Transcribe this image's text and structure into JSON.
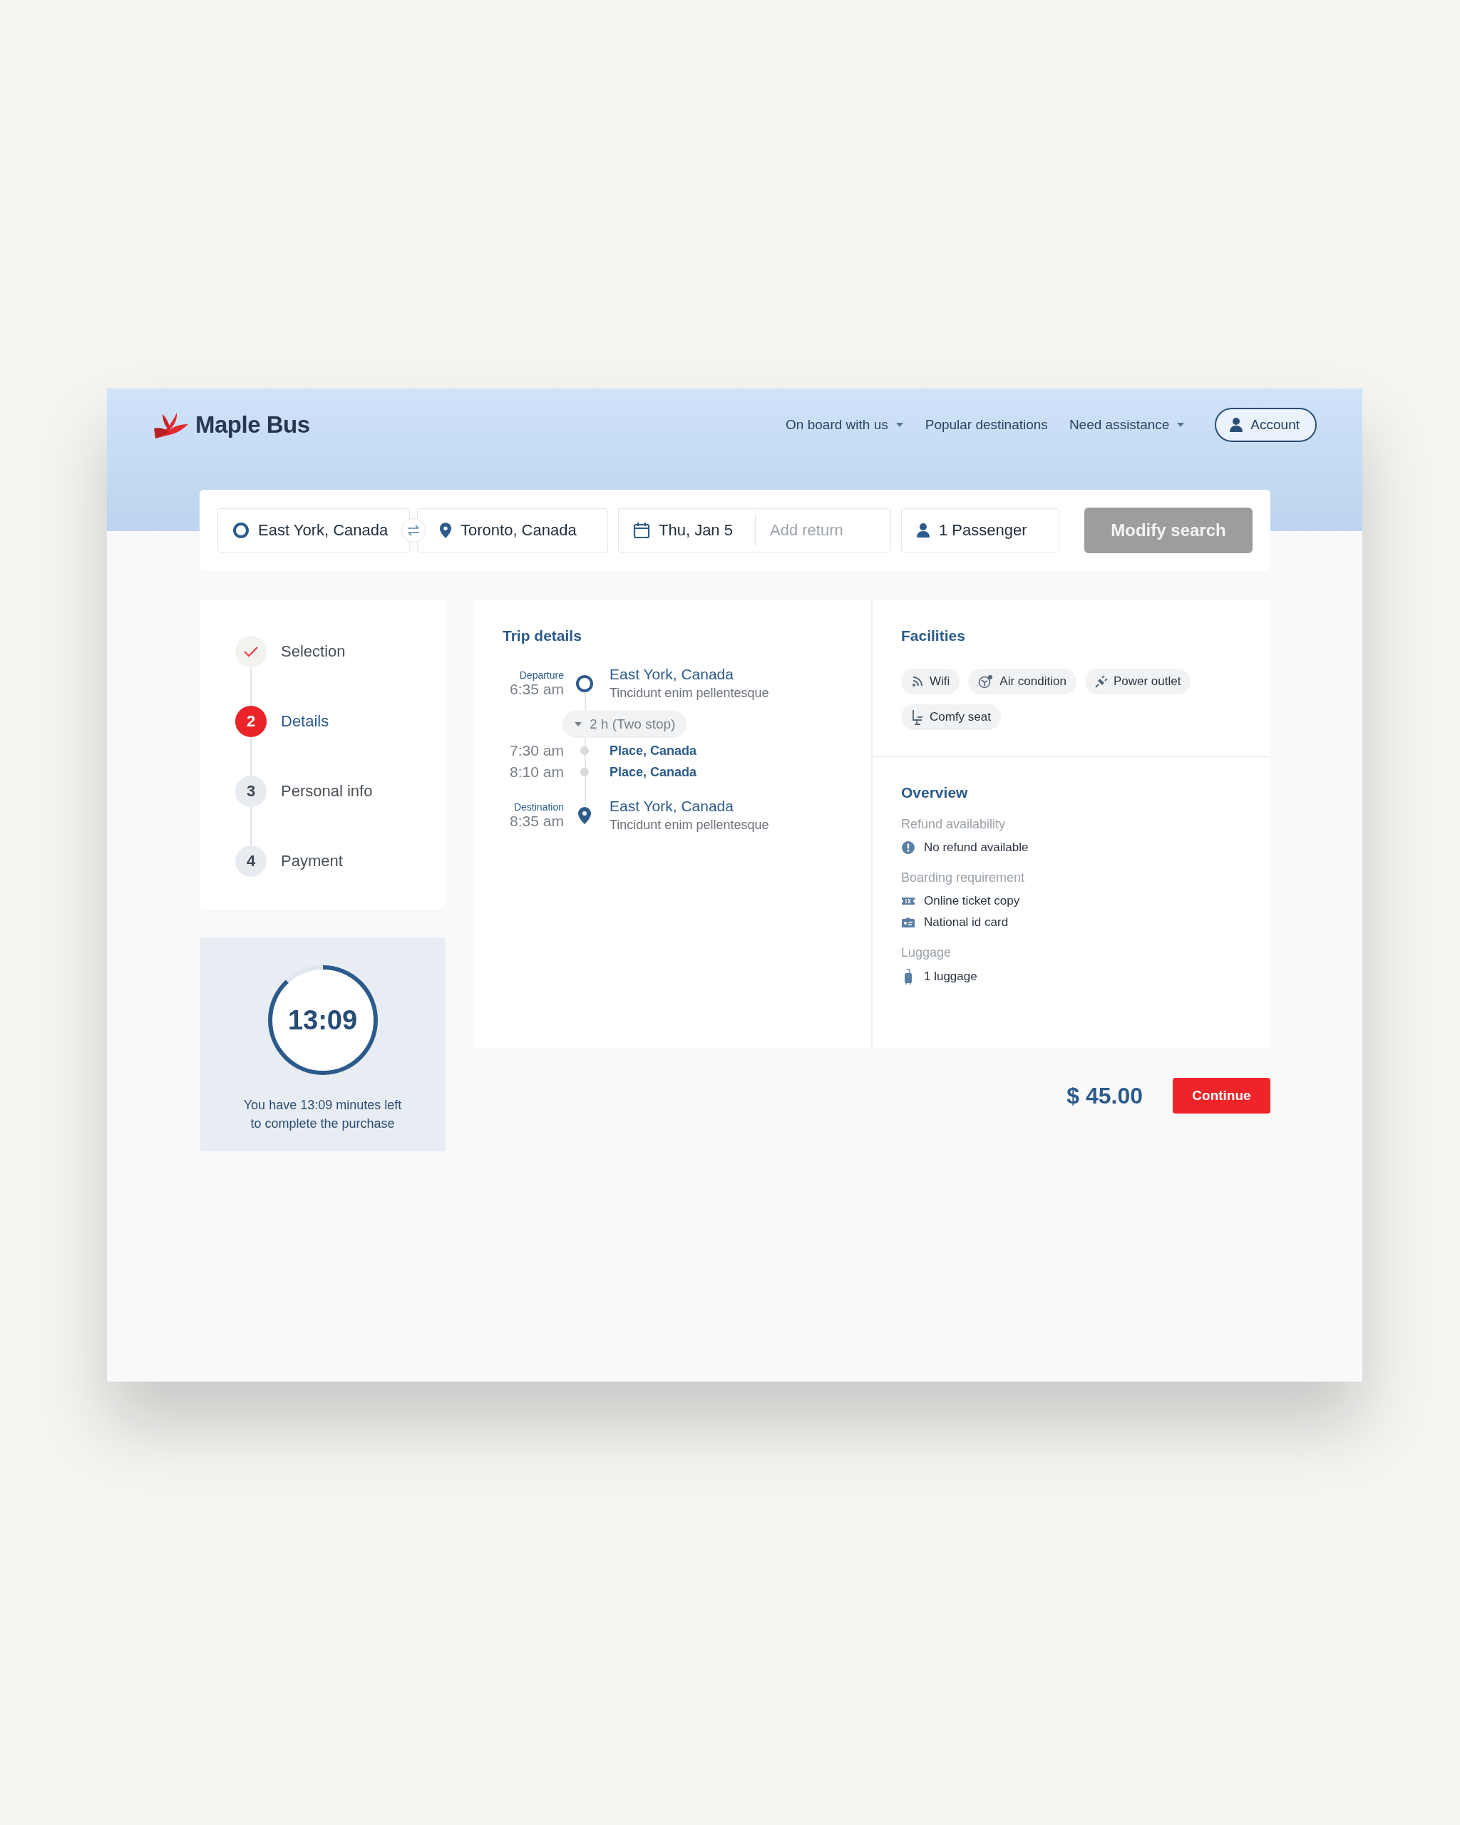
{
  "brand": {
    "name": "Maple Bus"
  },
  "nav": [
    {
      "label": "On board with us",
      "kind": "dropdown"
    },
    {
      "label": "Popular destinations",
      "kind": "link"
    },
    {
      "label": "Need assistance",
      "kind": "dropdown"
    }
  ],
  "account_button": "Account",
  "search": {
    "origin": "East York, Canada",
    "destination": "Toronto, Canada",
    "date": "Thu, Jan 5",
    "return_placeholder": "Add return",
    "passengers": "1 Passenger",
    "button": "Modify search"
  },
  "steps": [
    {
      "label": "Selection",
      "done": true,
      "selected": false
    },
    {
      "number": "2",
      "label": "Details",
      "done": false,
      "selected": true
    },
    {
      "number": "3",
      "label": "Personal info",
      "done": false,
      "selected": false
    },
    {
      "number": "4",
      "label": "Payment",
      "done": false,
      "selected": false
    }
  ],
  "timer": {
    "time": "13:09",
    "level": 0.88,
    "message": "You have 13:09 minutes left to complete the purchase"
  },
  "trip": {
    "title": "Trip details",
    "stops": [
      {
        "kind": "departure",
        "caption": "Departure",
        "time": "6:35 am",
        "place": "East York, Canada",
        "detail": "Tincidunt enim pellentesque"
      },
      {
        "kind": "duration",
        "label": "2 h (Two stop)"
      },
      {
        "kind": "stop",
        "time": "7:30 am",
        "place": "Place, Canada"
      },
      {
        "kind": "stop",
        "time": "8:10 am",
        "place": "Place, Canada"
      },
      {
        "kind": "destination",
        "caption": "Destination",
        "time": "8:35 am",
        "place": "East York, Canada",
        "detail": "Tincidunt enim pellentesque"
      }
    ]
  },
  "facilities": {
    "title": "Facilities",
    "items": [
      {
        "label": "Wifi",
        "kind": "wifi"
      },
      {
        "label": "Air condition",
        "kind": "air"
      },
      {
        "label": "Power outlet",
        "kind": "plug"
      },
      {
        "label": "Comfy seat",
        "kind": "seat"
      }
    ]
  },
  "overview": {
    "title": "Overview",
    "sections": [
      {
        "heading": "Refund availability",
        "items": [
          {
            "label": "No refund available",
            "kind": "alert"
          }
        ]
      },
      {
        "heading": "Boarding requirement",
        "items": [
          {
            "label": "Online ticket copy",
            "kind": "ticket"
          },
          {
            "label": "National id card",
            "kind": "idcard"
          }
        ]
      },
      {
        "heading": "Luggage",
        "items": [
          {
            "label": "1 luggage",
            "kind": "luggage"
          }
        ]
      }
    ]
  },
  "price": "$ 45.00",
  "continue_button": "Continue"
}
